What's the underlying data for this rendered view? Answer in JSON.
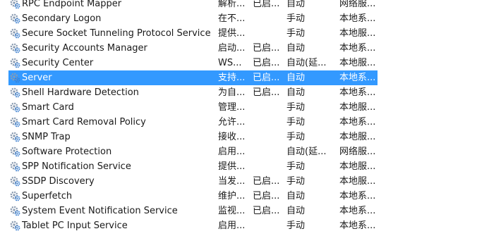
{
  "services": [
    {
      "name": "RPC Endpoint Mapper",
      "description": "解析...",
      "status": "已启...",
      "startup": "自动",
      "logon": "网络服..."
    },
    {
      "name": "Secondary Logon",
      "description": "在不...",
      "status": "",
      "startup": "手动",
      "logon": "本地系..."
    },
    {
      "name": "Secure Socket Tunneling Protocol Service",
      "description": "提供...",
      "status": "",
      "startup": "手动",
      "logon": "本地服..."
    },
    {
      "name": "Security Accounts Manager",
      "description": "启动...",
      "status": "已启...",
      "startup": "自动",
      "logon": "本地系..."
    },
    {
      "name": "Security Center",
      "description": "WS...",
      "status": "已启...",
      "startup": "自动(延...",
      "logon": "本地服..."
    },
    {
      "name": "Server",
      "description": "支持...",
      "status": "已启...",
      "startup": "自动",
      "logon": "本地系...",
      "selected": true
    },
    {
      "name": "Shell Hardware Detection",
      "description": "为自...",
      "status": "已启...",
      "startup": "自动",
      "logon": "本地系..."
    },
    {
      "name": "Smart Card",
      "description": "管理...",
      "status": "",
      "startup": "手动",
      "logon": "本地服..."
    },
    {
      "name": "Smart Card Removal Policy",
      "description": "允许...",
      "status": "",
      "startup": "手动",
      "logon": "本地系..."
    },
    {
      "name": "SNMP Trap",
      "description": "接收...",
      "status": "",
      "startup": "手动",
      "logon": "本地服..."
    },
    {
      "name": "Software Protection",
      "description": "启用...",
      "status": "",
      "startup": "自动(延...",
      "logon": "网络服..."
    },
    {
      "name": "SPP Notification Service",
      "description": "提供...",
      "status": "",
      "startup": "手动",
      "logon": "本地服..."
    },
    {
      "name": "SSDP Discovery",
      "description": "当发...",
      "status": "已启...",
      "startup": "手动",
      "logon": "本地服..."
    },
    {
      "name": "Superfetch",
      "description": "维护...",
      "status": "已启...",
      "startup": "自动",
      "logon": "本地系..."
    },
    {
      "name": "System Event Notification Service",
      "description": "监视...",
      "status": "已启...",
      "startup": "自动",
      "logon": "本地系..."
    },
    {
      "name": "Tablet PC Input Service",
      "description": "启用...",
      "status": "",
      "startup": "手动",
      "logon": "本地系..."
    }
  ],
  "icon": "gear-service-icon",
  "colors": {
    "selection": "#3399ff",
    "gear": "#8a9bb0",
    "gear_accent": "#3a7fd0"
  }
}
